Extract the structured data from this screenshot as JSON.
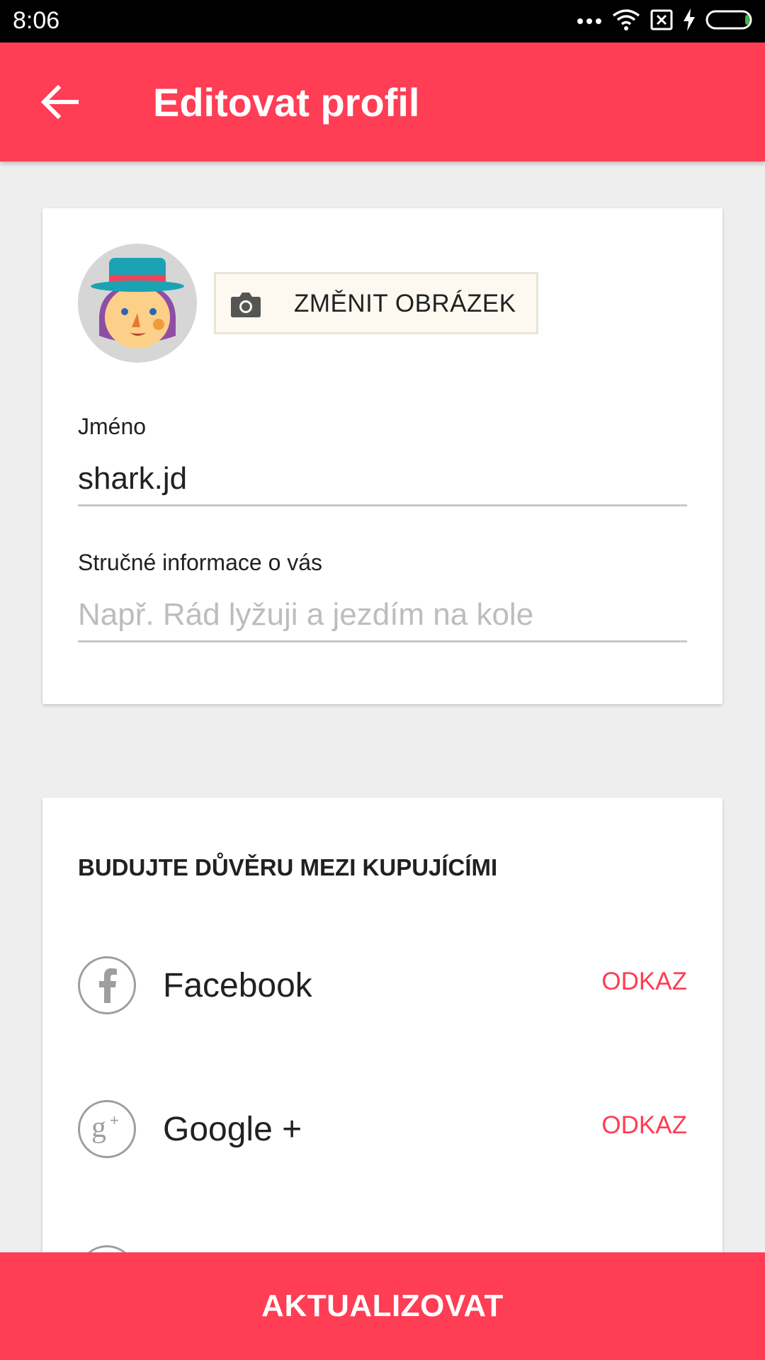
{
  "status_bar": {
    "time": "8:06",
    "icons": [
      "more-icon",
      "wifi-icon",
      "no-sim-icon",
      "charging-icon",
      "battery-icon"
    ]
  },
  "app_bar": {
    "title": "Editovat profil",
    "back_icon": "back-arrow-icon",
    "color": "#ff3d54"
  },
  "profile": {
    "change_image_label": "ZMĚNIT OBRÁZEK",
    "name_label": "Jméno",
    "name_value": "shark.jd",
    "about_label": "Stručné informace o vás",
    "about_placeholder": "Např. Rád lyžuji a jezdím na kole"
  },
  "trust": {
    "title": "BUDUJTE DŮVĚRU MEZI KUPUJÍCÍMI",
    "items": [
      {
        "label": "Facebook",
        "icon": "facebook-icon",
        "action": "ODKAZ"
      },
      {
        "label": "Google +",
        "icon": "google-plus-icon",
        "action": "ODKAZ"
      }
    ]
  },
  "bottom_button": {
    "label": "AKTUALIZOVAT"
  }
}
